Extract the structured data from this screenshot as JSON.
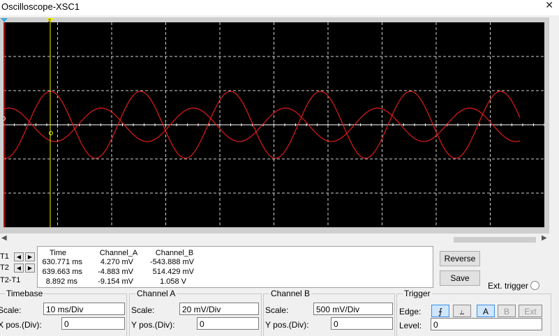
{
  "window": {
    "title": "Oscilloscope-XSC1",
    "close_glyph": "✕"
  },
  "cursors": {
    "t1_marker": "1",
    "t2_marker": "2"
  },
  "readout": {
    "headers": [
      "Time",
      "Channel_A",
      "Channel_B"
    ],
    "rows": [
      {
        "label": "T1",
        "time": "630.771 ms",
        "a": "4.270 mV",
        "b": "-543.888 mV"
      },
      {
        "label": "T2",
        "time": "639.663 ms",
        "a": "-4.883 mV",
        "b": "514.429 mV"
      },
      {
        "label": "T2-T1",
        "time": "8.892 ms",
        "a": "-9.154 mV",
        "b": "1.058 V"
      }
    ]
  },
  "buttons": {
    "reverse": "Reverse",
    "save": "Save",
    "ext_trigger": "Ext. trigger"
  },
  "timebase": {
    "title": "Timebase",
    "scale_label": "Scale:",
    "scale_value": "10 ms/Div",
    "xpos_label": "X pos.(Div):",
    "xpos_value": "0"
  },
  "channel_a": {
    "title": "Channel A",
    "scale_label": "Scale:",
    "scale_value": "20 mV/Div",
    "ypos_label": "Y pos.(Div):",
    "ypos_value": "0"
  },
  "channel_b": {
    "title": "Channel B",
    "scale_label": "Scale:",
    "scale_value": "500 mV/Div",
    "ypos_label": "Y pos.(Div):",
    "ypos_value": "0"
  },
  "trigger": {
    "title": "Trigger",
    "edge_label": "Edge:",
    "level_label": "Level:",
    "edge_rise": "⨍",
    "edge_fall": "⥿",
    "src_a": "A",
    "src_b": "B",
    "src_ext": "Ext",
    "level_value": "0"
  },
  "icons": {
    "left_arrow": "◀",
    "right_arrow": "▶"
  },
  "colors": {
    "trace": "#e21b1b",
    "screen": "#000000",
    "grid": "#cfcfcf",
    "cursor1": "#e21b1b",
    "cursor2": "#f2f200"
  }
}
